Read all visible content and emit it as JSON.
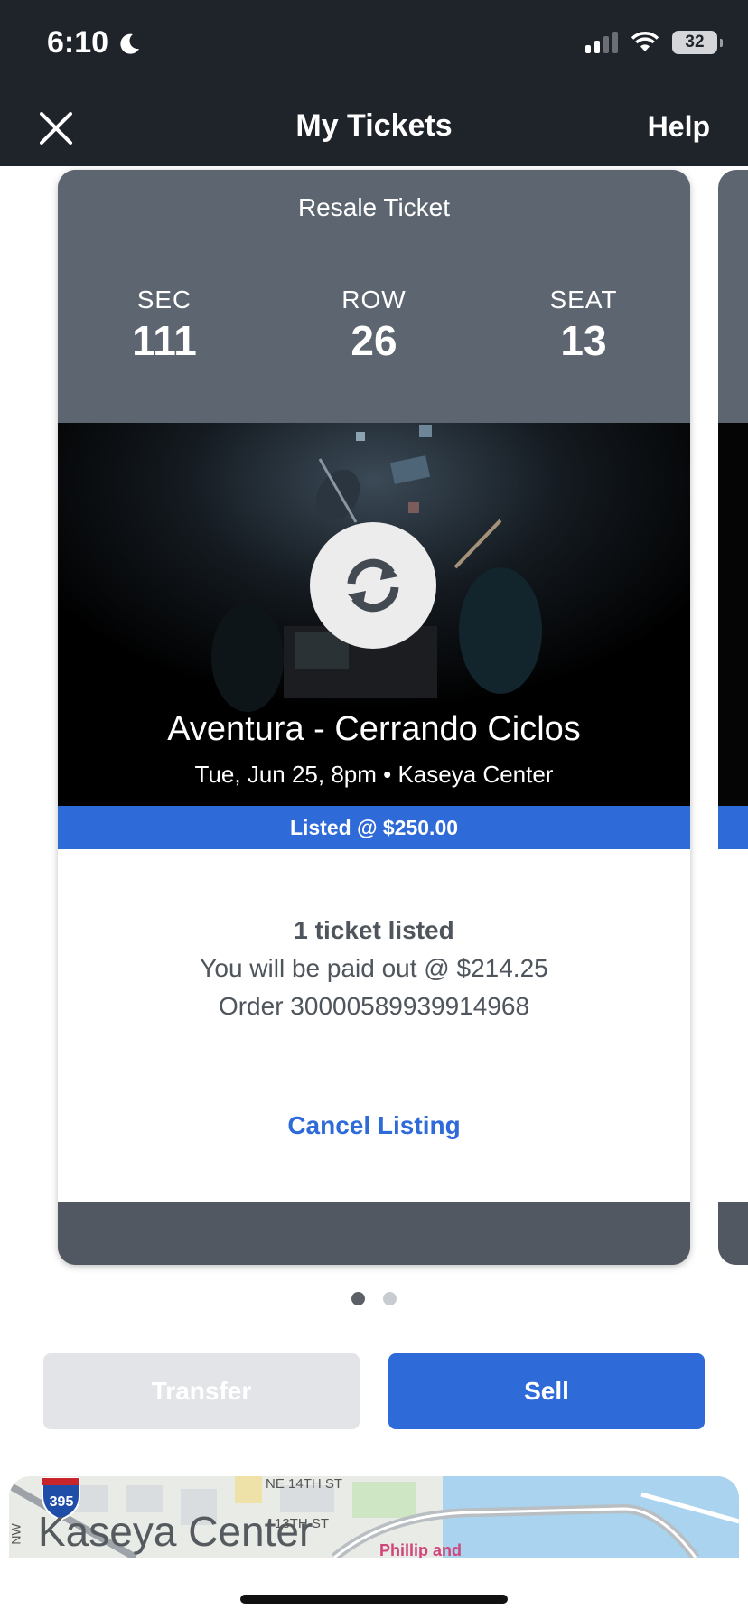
{
  "status_bar": {
    "time": "6:10",
    "battery": "32"
  },
  "nav": {
    "title": "My Tickets",
    "help_label": "Help"
  },
  "ticket": {
    "type": "Resale Ticket",
    "sec_label": "SEC",
    "sec": "111",
    "row_label": "ROW",
    "row": "26",
    "seat_label": "SEAT",
    "seat": "13",
    "event_name": "Aventura - Cerrando Ciclos",
    "event_details": "Tue, Jun 25, 8pm • Kaseya Center",
    "listed_price": "Listed @ $250.00",
    "listed_count": "1 ticket listed",
    "payout": "You will be paid out @ $214.25",
    "order": "Order 30000589939914968",
    "cancel_label": "Cancel Listing"
  },
  "pager": {
    "count": 2,
    "active": 1
  },
  "actions": {
    "transfer_label": "Transfer",
    "sell_label": "Sell"
  },
  "map": {
    "venue_name": "Kaseya Center",
    "street_1": "NE 14TH ST",
    "street_2": "13TH ST",
    "highway": "395",
    "side_label": "NW",
    "poi": "Phillip and"
  },
  "colors": {
    "accent": "#2f6ad9",
    "dark": "#1f242b",
    "card_header": "#5c6570",
    "card_footer": "#515861"
  }
}
